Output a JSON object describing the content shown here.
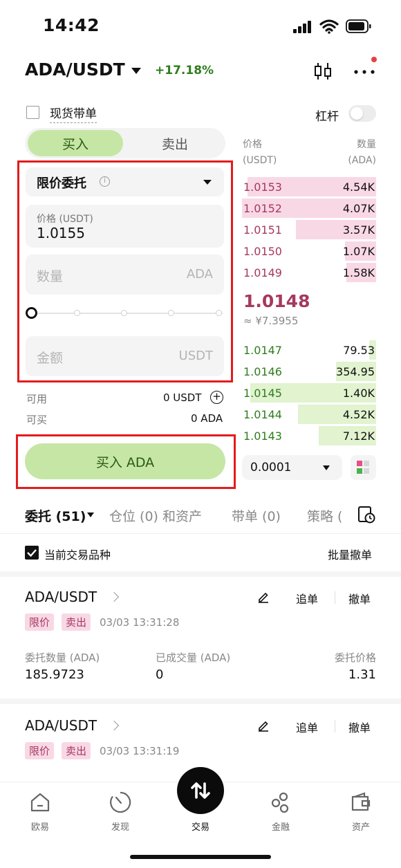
{
  "status_bar": {
    "time": "14:42"
  },
  "header": {
    "pair": "ADA/USDT",
    "change": "+17.18%"
  },
  "spot_with_order": {
    "label": "现货带单"
  },
  "leverage": {
    "label": "杠杆"
  },
  "trade_tabs": {
    "buy": "买入",
    "sell": "卖出"
  },
  "order_form": {
    "order_type": "限价委托",
    "price_label": "价格 (USDT)",
    "price_value": "1.0155",
    "qty_placeholder": "数量",
    "qty_unit": "ADA",
    "amount_placeholder": "金额",
    "amount_unit": "USDT",
    "available_label": "可用",
    "available_value": "0 USDT",
    "can_buy_label": "可买",
    "can_buy_value": "0 ADA",
    "submit_label": "买入 ADA"
  },
  "order_book": {
    "price_header": "价格",
    "price_unit": "(USDT)",
    "qty_header": "数量",
    "qty_unit": "(ADA)",
    "asks": [
      {
        "price": "1.0153",
        "qty": "4.54K",
        "depth": 0.96
      },
      {
        "price": "1.0152",
        "qty": "4.07K",
        "depth": 1.0
      },
      {
        "price": "1.0151",
        "qty": "3.57K",
        "depth": 0.6
      },
      {
        "price": "1.0150",
        "qty": "1.07K",
        "depth": 0.23
      },
      {
        "price": "1.0149",
        "qty": "1.58K",
        "depth": 0.22
      }
    ],
    "last_price": "1.0148",
    "last_price_cny": "≈ ¥7.3955",
    "bids": [
      {
        "price": "1.0147",
        "qty": "79.53",
        "depth": 0.05
      },
      {
        "price": "1.0146",
        "qty": "354.95",
        "depth": 0.3
      },
      {
        "price": "1.0145",
        "qty": "1.40K",
        "depth": 0.94
      },
      {
        "price": "1.0144",
        "qty": "4.52K",
        "depth": 0.58
      },
      {
        "price": "1.0143",
        "qty": "7.12K",
        "depth": 0.43
      }
    ],
    "precision": "0.0001"
  },
  "order_tabs": {
    "open": "委托 (51)",
    "positions": "仓位 (0) 和资产",
    "copy": "带单 (0)",
    "strategy": "策略 ("
  },
  "filter": {
    "current_pair": "当前交易品种",
    "cancel_all": "批量撤单"
  },
  "orders": [
    {
      "pair": "ADA/USDT",
      "type_tag": "限价",
      "side_tag": "卖出",
      "time": "03/03 13:31:28",
      "amend": "追单",
      "cancel": "撤单",
      "qty_label": "委托数量 (ADA)",
      "qty_value": "185.9723",
      "filled_label": "已成交量 (ADA)",
      "filled_value": "0",
      "price_label": "委托价格",
      "price_value": "1.31"
    },
    {
      "pair": "ADA/USDT",
      "type_tag": "限价",
      "side_tag": "卖出",
      "time": "03/03 13:31:19",
      "amend": "追单",
      "cancel": "撤单"
    }
  ],
  "nav": {
    "home": "欧易",
    "discover": "发现",
    "trade": "交易",
    "finance": "金融",
    "assets": "资产"
  }
}
